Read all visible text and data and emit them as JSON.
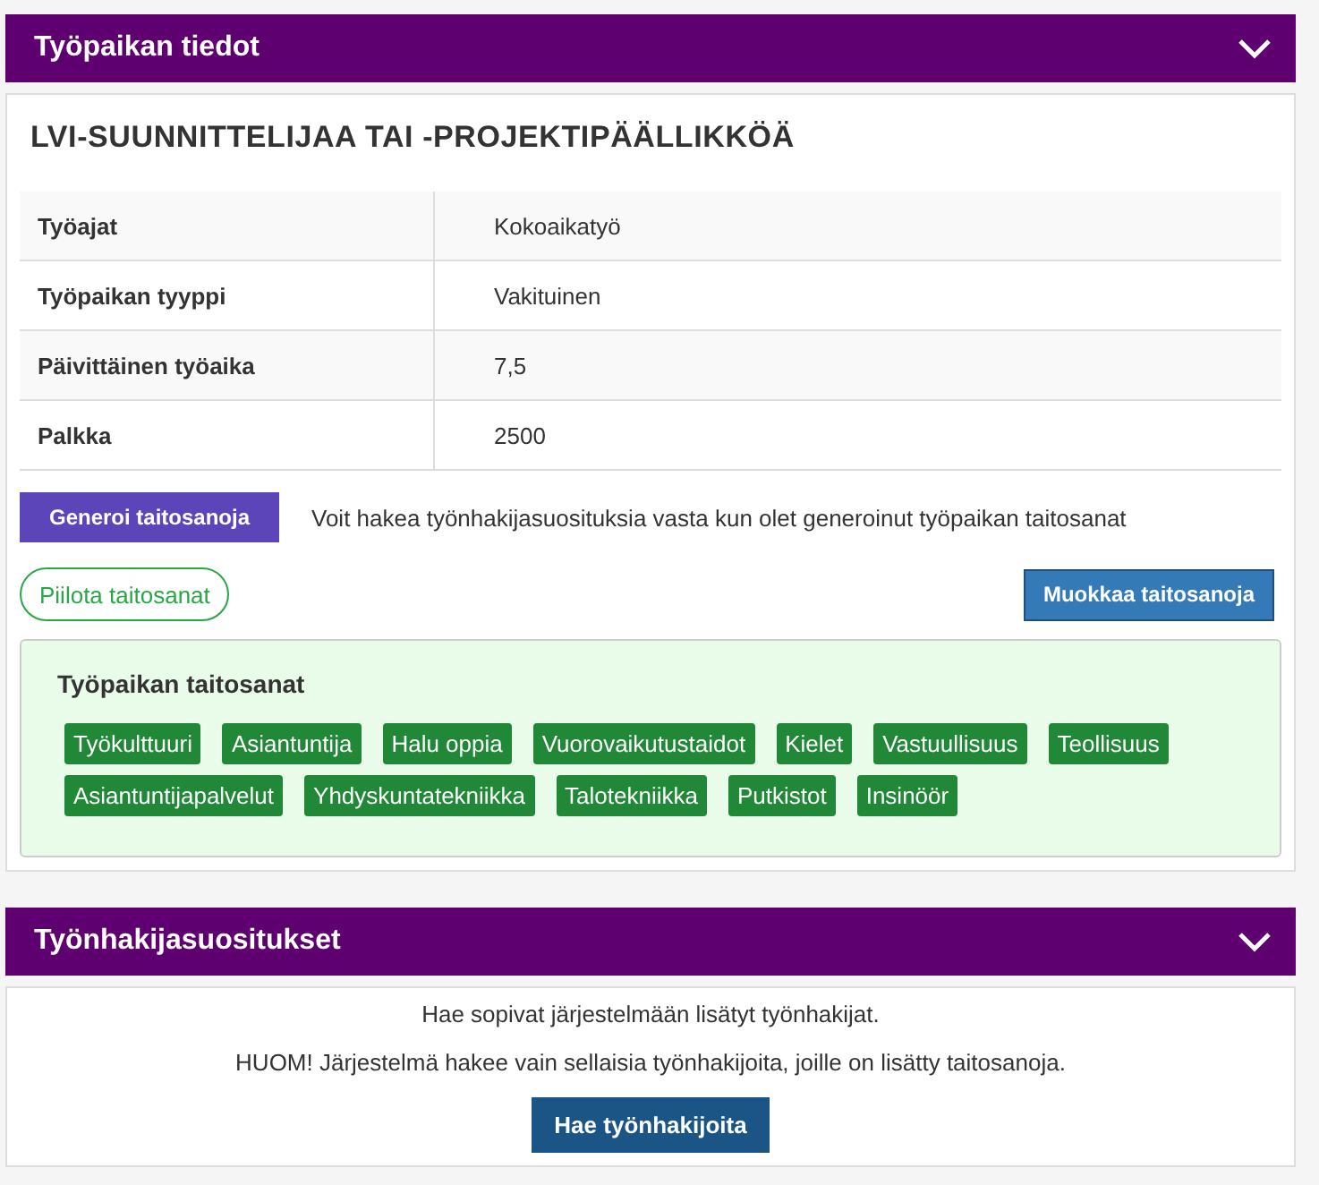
{
  "job_panel": {
    "title": "Työpaikan tiedot",
    "job_title": "LVI-SUUNNITTELIJAA TAI -PROJEKTIPÄÄLLIKKÖÄ",
    "details": [
      {
        "label": "Työajat",
        "value": "Kokoaikatyö"
      },
      {
        "label": "Työpaikan tyyppi",
        "value": "Vakituinen"
      },
      {
        "label": "Päivittäinen työaika",
        "value": "7,5"
      },
      {
        "label": "Palkka",
        "value": "2500"
      }
    ],
    "generate_button": "Generoi taitosanoja",
    "generate_note": "Voit hakea työnhakijasuosituksia vasta kun olet generoinut työpaikan taitosanat",
    "hide_button": "Piilota taitosanat",
    "edit_button": "Muokkaa taitosanoja",
    "skills": {
      "title": "Työpaikan taitosanat",
      "tags": [
        "Työkulttuuri",
        "Asiantuntija",
        "Halu oppia",
        "Vuorovaikutustaidot",
        "Kielet",
        "Vastuullisuus",
        "Teollisuus",
        "Asiantuntijapalvelut",
        "Yhdyskuntatekniikka",
        "Talotekniikka",
        "Putkistot",
        "Insinöör"
      ]
    }
  },
  "candidates_panel": {
    "title": "Työnhakijasuositukset",
    "lines": [
      "Hae sopivat järjestelmään lisätyt työnhakijat.",
      "HUOM! Järjestelmä hakee vain sellaisia työnhakijoita, joille on lisätty taitosanoja."
    ],
    "search_button": "Hae työnhakijoita"
  }
}
